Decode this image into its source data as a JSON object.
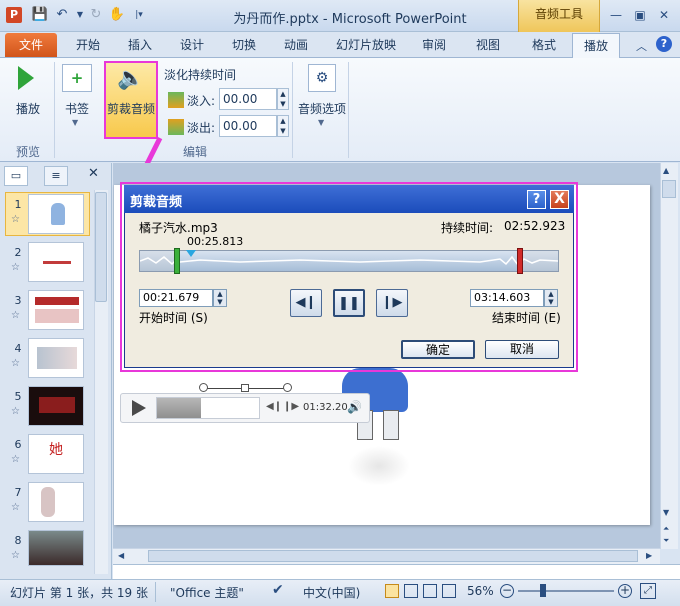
{
  "app": {
    "title": "为丹而作.pptx  -  Microsoft PowerPoint",
    "icon_letter": "P",
    "context_tab": "音频工具"
  },
  "tabs": {
    "file": "文件",
    "items": [
      "开始",
      "插入",
      "设计",
      "切换",
      "动画",
      "幻灯片放映",
      "审阅",
      "视图",
      "格式",
      "播放"
    ],
    "selected": "播放"
  },
  "ribbon": {
    "play_label": "播放",
    "preview_group": "预览",
    "bookmark_label": "书签",
    "trim_label": "剪裁音频",
    "fade_title": "淡化持续时间",
    "fade_in_label": "淡入:",
    "fade_in_value": "00.00",
    "fade_out_label": "淡出:",
    "fade_out_value": "00.00",
    "edit_group": "编辑",
    "audio_options_label": "音频选项"
  },
  "slides": {
    "numbers": [
      "1",
      "2",
      "3",
      "4",
      "5",
      "6",
      "7",
      "8"
    ],
    "star": "☆",
    "thumb_text_6": "她"
  },
  "dialog": {
    "title": "剪裁音频",
    "help": "?",
    "close": "X",
    "filename": "橘子汽水.mp3",
    "duration_label": "持续时间:",
    "duration_value": "02:52.923",
    "current_time": "00:25.813",
    "start_value": "00:21.679",
    "start_label": "开始时间 (S)",
    "end_value": "03:14.603",
    "end_label": "结束时间 (E)",
    "ok": "确定",
    "cancel": "取消"
  },
  "player": {
    "time": "01:32.20"
  },
  "status": {
    "slide_info": "幻灯片 第 1 张，共 19 张",
    "theme": "\"Office 主题\"",
    "language": "中文(中国)",
    "zoom": "56%"
  },
  "colors": {
    "highlight": "#e838d9",
    "dialog_title": "#1b4cbb",
    "file_tab": "#d1541a"
  }
}
